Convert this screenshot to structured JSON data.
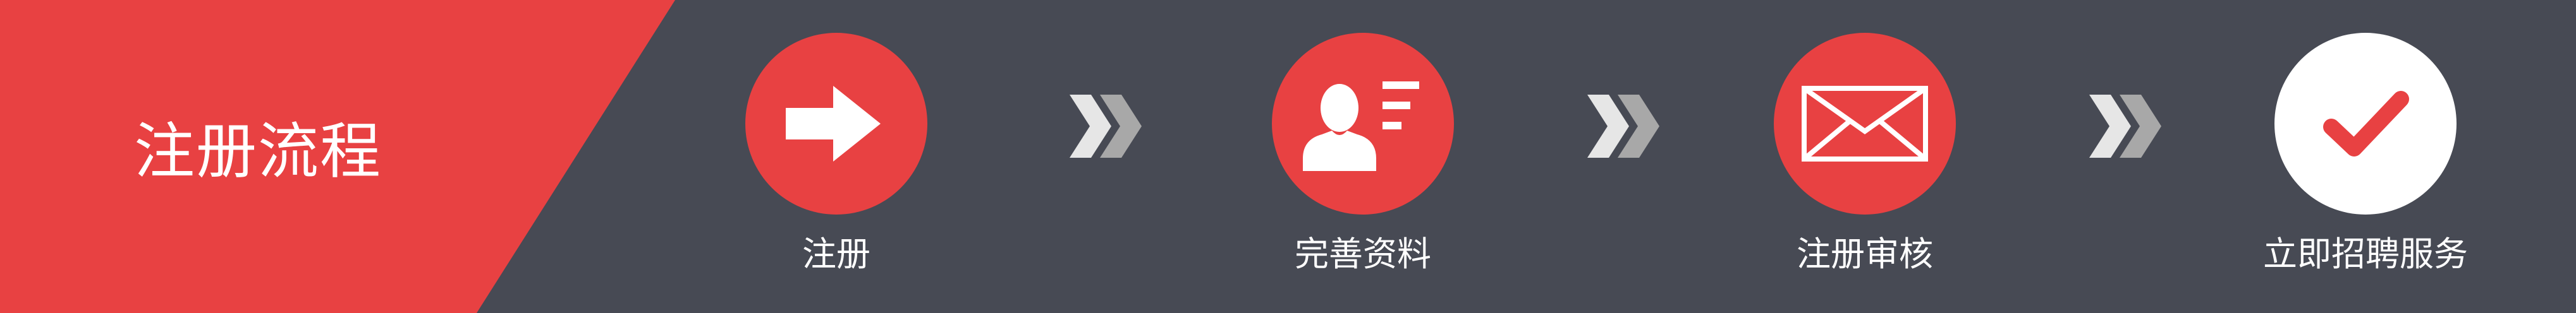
{
  "title": "注册流程",
  "colors": {
    "background": "#474a54",
    "accent": "#e84142",
    "white": "#ffffff",
    "chevron_light": "#e6e6e6",
    "chevron_gray": "#a8a8a8"
  },
  "steps": [
    {
      "label": "注册",
      "icon": "arrow-right-icon",
      "circle_color": "#e84142"
    },
    {
      "label": "完善资料",
      "icon": "profile-card-icon",
      "circle_color": "#e84142"
    },
    {
      "label": "注册审核",
      "icon": "envelope-icon",
      "circle_color": "#e84142"
    },
    {
      "label": "立即招聘服务",
      "icon": "checkmark-icon",
      "circle_color": "#ffffff"
    }
  ]
}
